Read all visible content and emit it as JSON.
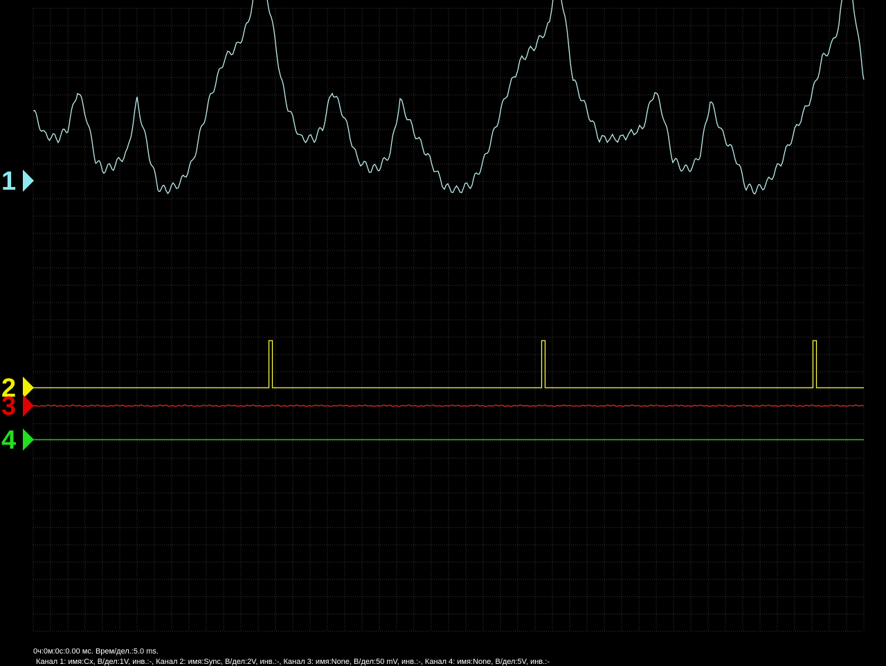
{
  "colors": {
    "background": "#000000",
    "grid": "#3c3c3c",
    "channel1": "#bff0f0",
    "channel2": "#ffff40",
    "channel3": "#e02020",
    "channel4": "#30e030",
    "marker1": "#8fe8f0",
    "marker2": "#f0f000",
    "marker3": "#e00000",
    "marker4": "#20e020"
  },
  "status": {
    "time_line": "0ч:0м:0с:0.00 мс. Врем/дел.:5.0 ms.",
    "channels_line": "Канал 1: имя:Cx, В/дел:1V, инв.:-, Канал 2: имя:Sync, В/дел:2V, инв.:-, Канал 3: имя:None, В/дел:50 mV, инв.:-, Канал 4: имя:None, В/дел:5V, инв.:-"
  },
  "markers": [
    {
      "label": "1",
      "color": "#8fe8f0"
    },
    {
      "label": "2",
      "color": "#f0f000"
    },
    {
      "label": "3",
      "color": "#e00000"
    },
    {
      "label": "4",
      "color": "#20e020"
    }
  ],
  "chart_data": {
    "type": "line",
    "time_per_div_ms": 5.0,
    "grid": true,
    "x_range_ms": [
      0,
      60
    ],
    "series": [
      {
        "name": "Cx",
        "volts_per_div": "1V",
        "x_ms": [
          0,
          0.8,
          1.8,
          2.5,
          3.2,
          3.8,
          4.5,
          5.0,
          5.8,
          6.8,
          7.5,
          8.0,
          8.4,
          9.0,
          9.6,
          10.6,
          11.5,
          12.1,
          12.8,
          13.8,
          14.8,
          15.5,
          16.4,
          17.2,
          17.9,
          18.4,
          19.3,
          20.3,
          20.9,
          21.6,
          22.4,
          23.4,
          24.4,
          25.1,
          25.8,
          26.5,
          27.5,
          28.5,
          29.7,
          30.7,
          31.7,
          32.5,
          33.3,
          34.1,
          35.3,
          36.3,
          37.3,
          37.8,
          38.4,
          39.0,
          39.9,
          40.9,
          42.4,
          44.0,
          44.9,
          45.5,
          46.2,
          47.0,
          47.7,
          48.2,
          48.9,
          49.7,
          50.7,
          51.5,
          52.2,
          53.0,
          54.0,
          55.0,
          56.2,
          57.0,
          57.7,
          58.2,
          58.8,
          59.4,
          60.0
        ],
        "y_div": [
          2.8,
          2.1,
          2.0,
          2.3,
          3.4,
          2.7,
          1.4,
          1.1,
          1.2,
          1.6,
          3.1,
          2.2,
          1.5,
          0.6,
          0.5,
          0.7,
          1.3,
          2.2,
          3.2,
          4.3,
          4.7,
          5.3,
          7.0,
          5.5,
          3.7,
          2.9,
          2.0,
          2.0,
          2.3,
          3.4,
          2.7,
          1.4,
          1.1,
          1.2,
          1.6,
          3.1,
          2.2,
          1.5,
          0.6,
          0.5,
          0.7,
          1.3,
          2.2,
          3.2,
          4.3,
          4.7,
          5.3,
          7.0,
          5.5,
          3.7,
          2.9,
          2.0,
          2.0,
          2.3,
          3.4,
          2.7,
          1.4,
          1.1,
          1.2,
          1.6,
          3.1,
          2.2,
          1.5,
          0.6,
          0.5,
          0.7,
          1.3,
          2.2,
          3.2,
          4.3,
          4.7,
          5.3,
          7.0,
          5.5,
          3.7,
          2.2
        ]
      },
      {
        "name": "Sync",
        "volts_per_div": "2V",
        "baseline_div": 0,
        "pulse_height_div": 1.7,
        "pulse_times_ms": [
          17.1,
          36.8,
          56.4
        ],
        "pulse_width_ms": 0.15
      },
      {
        "name": "None",
        "volts_per_div": "50 mV",
        "baseline_div": 0,
        "noise": true
      },
      {
        "name": "None",
        "volts_per_div": "5V",
        "baseline_div": 0
      }
    ]
  }
}
